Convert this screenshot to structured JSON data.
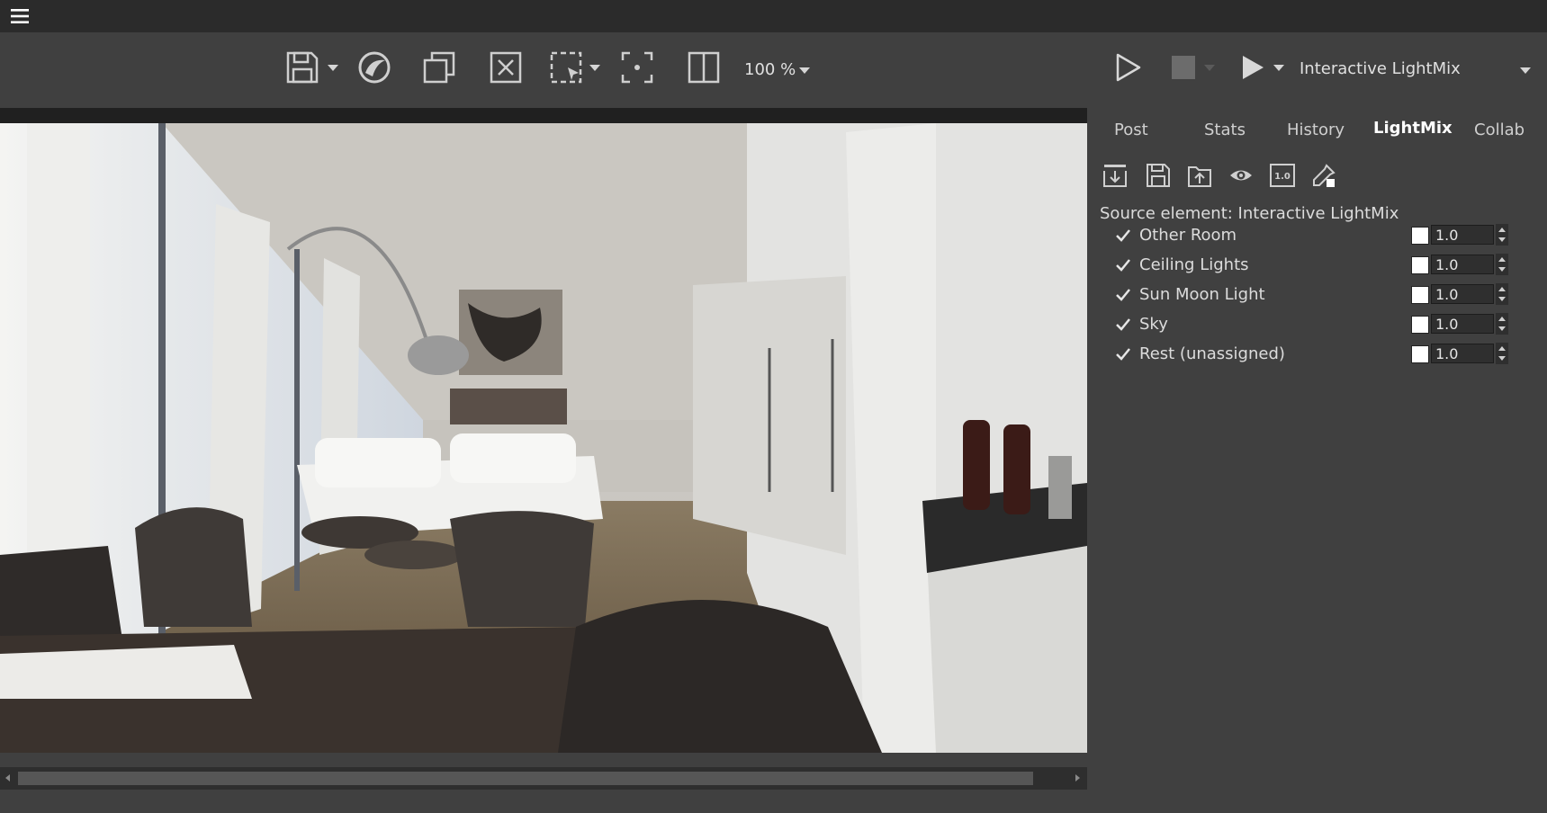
{
  "toolbar": {
    "zoom_value": "100 %",
    "render_element": "Interactive LightMix"
  },
  "panel": {
    "tabs": [
      {
        "label": "Post"
      },
      {
        "label": "Stats"
      },
      {
        "label": "History"
      },
      {
        "label": "LightMix"
      },
      {
        "label": "Collab"
      }
    ],
    "active_tab": "LightMix",
    "source_element_label": "Source element: Interactive LightMix",
    "multiplier_icon_text": "1.0",
    "lightmix": [
      {
        "name": "Other Room",
        "checked": true,
        "color": "#ffffff",
        "value": "1.0"
      },
      {
        "name": "Ceiling Lights",
        "checked": true,
        "color": "#ffffff",
        "value": "1.0"
      },
      {
        "name": "Sun Moon Light",
        "checked": true,
        "color": "#ffffff",
        "value": "1.0"
      },
      {
        "name": "Sky",
        "checked": true,
        "color": "#ffffff",
        "value": "1.0"
      },
      {
        "name": "Rest (unassigned)",
        "checked": true,
        "color": "#ffffff",
        "value": "1.0"
      }
    ]
  },
  "colors": {
    "background": "#404040",
    "topbar": "#2b2b2b",
    "input_bg": "#2f2f2f"
  }
}
